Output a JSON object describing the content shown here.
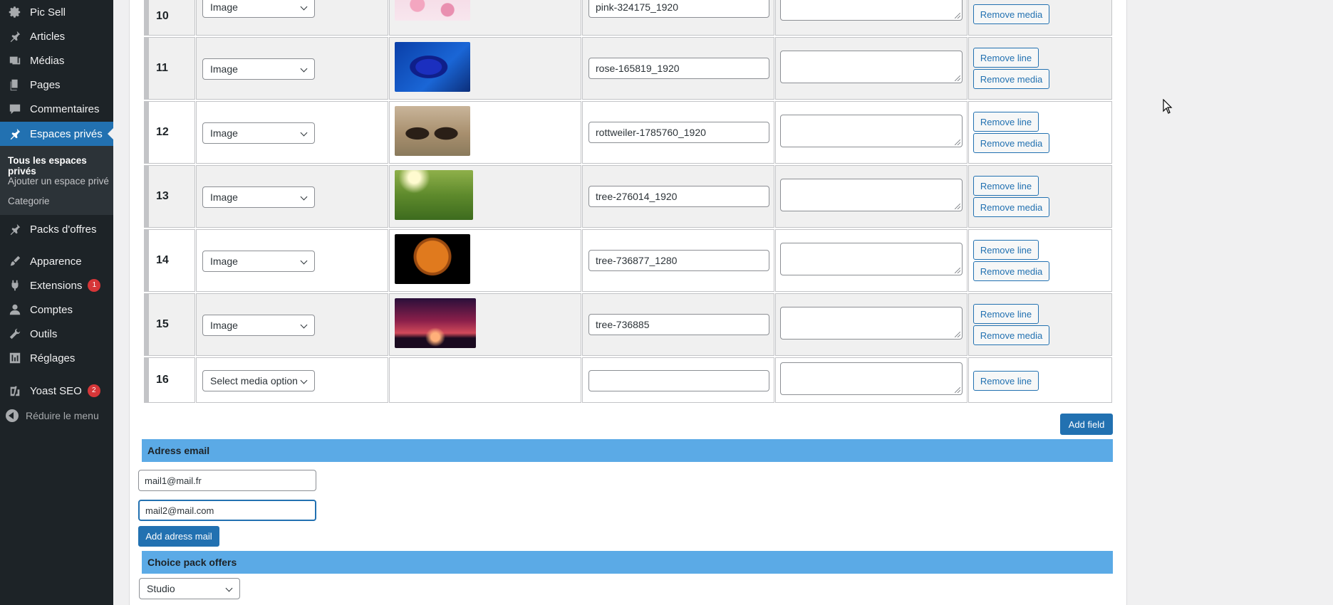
{
  "sidebar": {
    "items": [
      {
        "label": "Pic Sell",
        "icon": "gear-icon"
      },
      {
        "label": "Articles",
        "icon": "pin-icon"
      },
      {
        "label": "Médias",
        "icon": "media-icon"
      },
      {
        "label": "Pages",
        "icon": "pages-icon"
      },
      {
        "label": "Commentaires",
        "icon": "comment-icon"
      },
      {
        "label": "Espaces privés",
        "icon": "pin-icon"
      },
      {
        "label": "Packs d'offres",
        "icon": "pin-icon"
      },
      {
        "label": "Apparence",
        "icon": "brush-icon"
      },
      {
        "label": "Extensions",
        "icon": "plugin-icon",
        "badge": "1"
      },
      {
        "label": "Comptes",
        "icon": "user-icon"
      },
      {
        "label": "Outils",
        "icon": "wrench-icon"
      },
      {
        "label": "Réglages",
        "icon": "settings-icon"
      },
      {
        "label": "Yoast SEO",
        "icon": "yoast-icon",
        "badge": "2"
      }
    ],
    "submenu": [
      "Tous les espaces privés",
      "Ajouter un espace privé",
      "Categorie"
    ],
    "collapse_label": "Réduire le menu"
  },
  "media_rows": [
    {
      "num": "10",
      "type": "Image",
      "name": "pink-324175_1920",
      "thumb": "pink"
    },
    {
      "num": "11",
      "type": "Image",
      "name": "rose-165819_1920",
      "thumb": "rose"
    },
    {
      "num": "12",
      "type": "Image",
      "name": "rottweiler-1785760_1920",
      "thumb": "dogs"
    },
    {
      "num": "13",
      "type": "Image",
      "name": "tree-276014_1920",
      "thumb": "meadow"
    },
    {
      "num": "14",
      "type": "Image",
      "name": "tree-736877_1280",
      "thumb": "moon"
    },
    {
      "num": "15",
      "type": "Image",
      "name": "tree-736885",
      "thumb": "sunset"
    },
    {
      "num": "16",
      "type": "Select media option",
      "name": "",
      "thumb": ""
    }
  ],
  "buttons": {
    "remove_line": "Remove line",
    "remove_media": "Remove media",
    "add_field": "Add field",
    "add_mail": "Add adress mail"
  },
  "email_section": {
    "title": "Adress email",
    "emails": [
      "mail1@mail.fr",
      "mail2@mail.com"
    ]
  },
  "pack_section": {
    "title": "Choice pack offers",
    "selected": "Studio"
  },
  "colors": {
    "accent": "#2271b1",
    "section_bar": "#5baae6",
    "sidebar_bg": "#1d2327",
    "badge": "#d63638"
  }
}
